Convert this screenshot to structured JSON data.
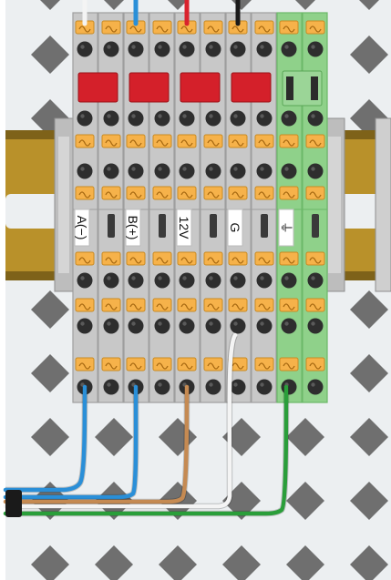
{
  "scene": {
    "colors": {
      "panel": "#eceff1",
      "diamond": "#616161",
      "rail": "#b9912a",
      "rail_dark": "#7e6219",
      "terminal_gray": "#c8c8c8",
      "terminal_dark": "#9e9e9e",
      "terminal_green": "#8fd18a",
      "clamp_orange": "#f6b24a",
      "screw_black": "#2e2e2e",
      "fuse_red": "#d4202a",
      "wire_blue": "#2a8fd8",
      "wire_brown": "#c58a52",
      "wire_white": "#f4f4f4",
      "wire_green": "#2a9e3a",
      "wire_black": "#1a1a1a",
      "wire_red": "#d9232d"
    },
    "terminals": [
      {
        "label": "A(−)",
        "fused": true,
        "earth": false,
        "top_wire": "wire_white",
        "bottom_wire": "wire_blue"
      },
      {
        "label": "B(+)",
        "fused": true,
        "earth": false,
        "top_wire": "wire_blue",
        "bottom_wire": "wire_blue"
      },
      {
        "label": "12V",
        "fused": true,
        "earth": false,
        "top_wire": "wire_red",
        "bottom_wire": "wire_brown"
      },
      {
        "label": "G",
        "fused": true,
        "earth": false,
        "top_wire": "wire_black",
        "bottom_wire": "wire_white"
      },
      {
        "label": "⏚",
        "fused": false,
        "earth": true,
        "top_wire": null,
        "bottom_wire": "wire_green"
      }
    ]
  }
}
